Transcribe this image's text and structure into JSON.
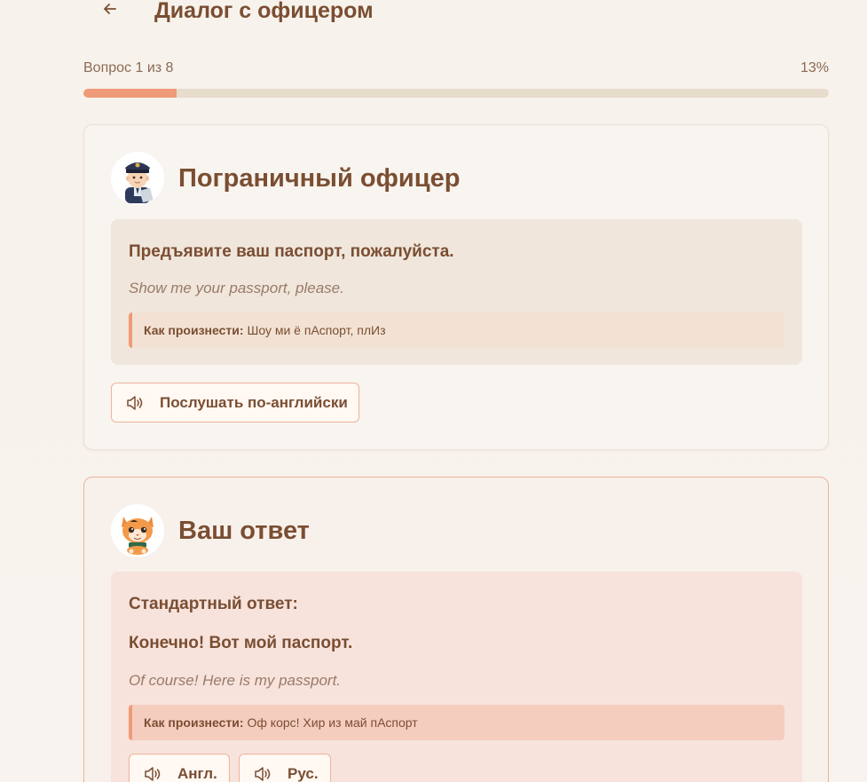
{
  "header": {
    "title": "Диалог с офицером",
    "back_icon": "arrow-left-icon"
  },
  "progress": {
    "label": "Вопрос 1 из 8",
    "percent_label": "13%",
    "fraction": 0.125,
    "fill_color": "#ef9a78"
  },
  "officer": {
    "title": "Пограничный офицер",
    "avatar_icon": "police-officer-avatar",
    "phrase_ru": "Предъявите ваш паспорт, пожалуйста.",
    "phrase_en": "Show me your passport, please.",
    "pron_label": "Как произнести:",
    "pron_text": "Шоу ми ё пАспорт, плИз",
    "listen_label": "Послушать по-английски",
    "listen_icon": "speaker-icon"
  },
  "answer": {
    "title": "Ваш ответ",
    "avatar_icon": "cat-avatar",
    "standard_label": "Стандартный ответ:",
    "phrase_ru": "Конечно! Вот мой паспорт.",
    "phrase_en": "Of course! Here is my passport.",
    "pron_label": "Как произнести:",
    "pron_text": "Оф корс! Хир из май пАспорт",
    "btn_en": "Англ.",
    "btn_ru": "Рус."
  },
  "colors": {
    "accent": "#ef9a78",
    "text": "#7a4e32",
    "background": "#f7f2ec"
  }
}
